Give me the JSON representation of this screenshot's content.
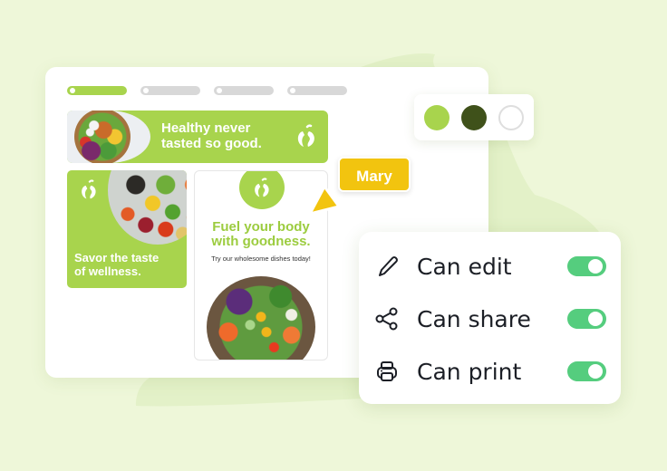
{
  "colors": {
    "background": "#eef7d9",
    "accent_green": "#a8d44d",
    "dark_green": "#3f511a",
    "toggle_on": "#55cd7e",
    "cursor_yellow": "#f2c40f"
  },
  "editor": {
    "tabs": [
      {
        "name": "tab-1",
        "active": true
      },
      {
        "name": "tab-2",
        "active": false
      },
      {
        "name": "tab-3",
        "active": false
      },
      {
        "name": "tab-4",
        "active": false
      }
    ],
    "banner": {
      "line1": "Healthy never",
      "line2": "tasted so good.",
      "icon": "apple-logo-icon"
    },
    "card_savor": {
      "line1": "Savor the taste",
      "line2": "of wellness.",
      "icon": "apple-logo-icon"
    },
    "card_fuel": {
      "line1": "Fuel your body",
      "line2": "with goodness.",
      "subtitle": "Try our wholesome dishes today!",
      "icon": "apple-logo-icon"
    }
  },
  "palette": {
    "swatches": [
      {
        "name": "light-green",
        "color": "#a8d44d"
      },
      {
        "name": "dark-green",
        "color": "#3f511a"
      },
      {
        "name": "white",
        "color": "#ffffff"
      }
    ]
  },
  "collaborator": {
    "name": "Mary"
  },
  "permissions": [
    {
      "label": "Can edit",
      "icon": "pencil-icon",
      "enabled": true
    },
    {
      "label": "Can share",
      "icon": "share-icon",
      "enabled": true
    },
    {
      "label": "Can print",
      "icon": "printer-icon",
      "enabled": true
    }
  ]
}
